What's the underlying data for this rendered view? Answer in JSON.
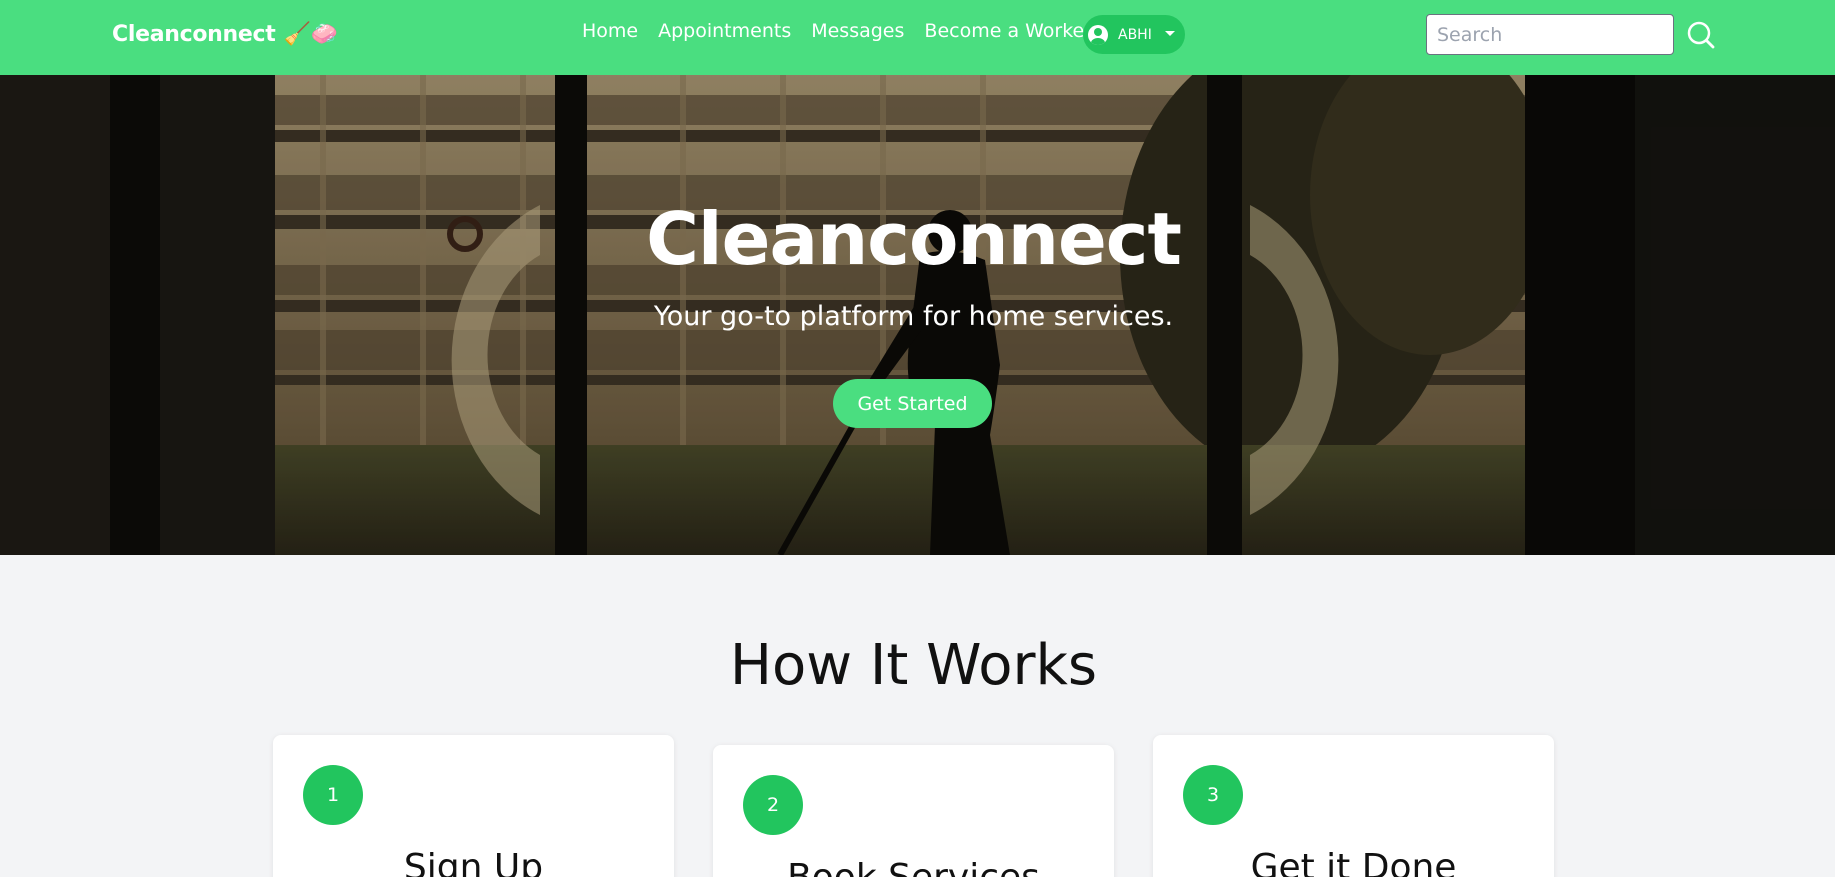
{
  "navbar": {
    "brand": "Cleanconnect",
    "brand_emoji": "🧹🧼",
    "links": [
      "Home",
      "Appointments",
      "Messages",
      "Become a Worker"
    ],
    "user_label": "ABHI",
    "search_placeholder": "Search"
  },
  "hero": {
    "title": "Cleanconnect",
    "subtitle": "Your go-to platform for home services.",
    "cta_label": "Get Started"
  },
  "how_it_works": {
    "title": "How It Works",
    "steps": [
      {
        "number": "1",
        "title": "Sign Up"
      },
      {
        "number": "2",
        "title": "Book Services"
      },
      {
        "number": "3",
        "title": "Get it Done"
      }
    ]
  },
  "colors": {
    "navbar": "#4ade80",
    "accent": "#22c55e",
    "background": "#f3f4f6"
  },
  "icons": [
    "broom-icon",
    "soap-icon",
    "user-circle-icon",
    "caret-down-icon",
    "search-icon"
  ]
}
